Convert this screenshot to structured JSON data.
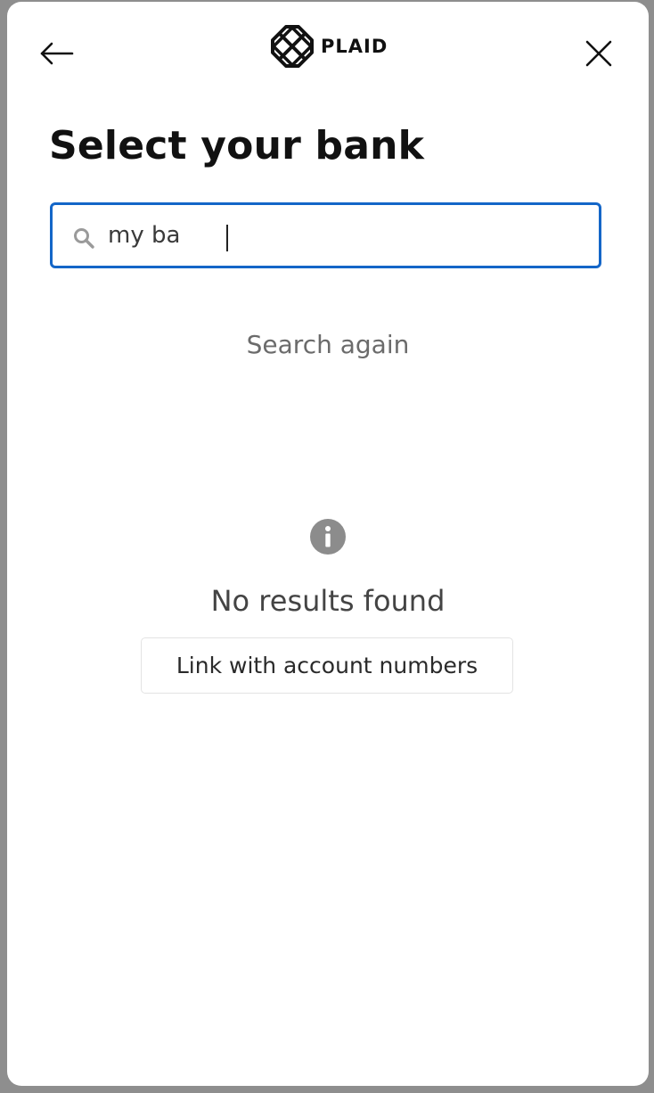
{
  "header": {
    "logo_text": "PLAID",
    "back_icon": "arrow-left-icon",
    "close_icon": "close-icon"
  },
  "main": {
    "title": "Select your bank",
    "search": {
      "value": "my ba",
      "icon": "search-icon"
    },
    "search_again_label": "Search again",
    "empty_state": {
      "icon": "info-icon",
      "message": "No results found",
      "button_label": "Link with account numbers"
    }
  },
  "colors": {
    "accent": "#1466c8",
    "text": "#111111",
    "muted": "#6b6b6b"
  }
}
